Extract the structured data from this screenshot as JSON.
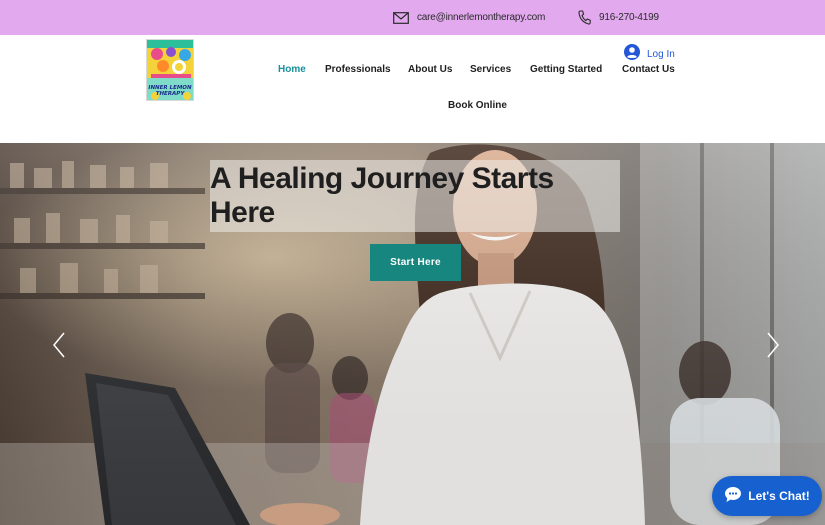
{
  "topbar": {
    "background": "#e3a9ee",
    "email": {
      "icon": "mail-icon",
      "text": "care@innerlemontherapy.com"
    },
    "phone": {
      "icon": "phone-icon",
      "text": "916-270-4199"
    }
  },
  "header": {
    "logo": {
      "text": "INNER LEMON THERAPY"
    },
    "login": {
      "icon": "user-avatar-icon",
      "label": "Log In"
    },
    "nav": [
      {
        "label": "Home",
        "active": true
      },
      {
        "label": "Professionals",
        "active": false
      },
      {
        "label": "About Us",
        "active": false
      },
      {
        "label": "Services",
        "active": false
      },
      {
        "label": "Getting Started",
        "active": false
      },
      {
        "label": "Contact Us",
        "active": false
      },
      {
        "label": "Book Online",
        "active": false
      }
    ]
  },
  "hero": {
    "headline": "A Healing Journey Starts Here",
    "cta_label": "Start Here",
    "prev_icon": "chevron-left-icon",
    "next_icon": "chevron-right-icon"
  },
  "chat": {
    "icon": "chat-bubble-icon",
    "label": "Let's Chat!"
  },
  "colors": {
    "accent": "#17919a",
    "cta": "#17867f",
    "login_link": "#2457d6",
    "chat": "#1660cf"
  }
}
